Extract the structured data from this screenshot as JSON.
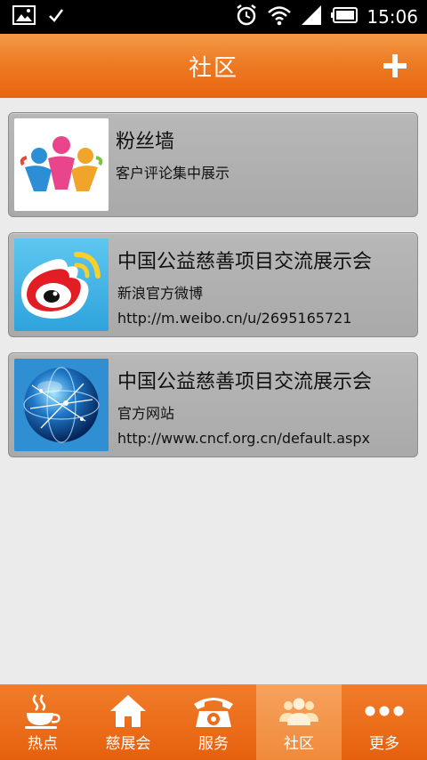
{
  "status_bar": {
    "time": "15:06"
  },
  "header": {
    "title": "社区",
    "add_icon": "plus-icon"
  },
  "cards": [
    {
      "title": "粉丝墙",
      "subtitle": "客户评论集中展示",
      "link": "",
      "thumb_icon": "fans-wall-logo"
    },
    {
      "title": "中国公益慈善项目交流展示会",
      "subtitle": "新浪官方微博",
      "link": "http://m.weibo.cn/u/2695165721",
      "thumb_icon": "weibo-logo"
    },
    {
      "title": "中国公益慈善项目交流展示会",
      "subtitle": "官方网站",
      "link": "http://www.cncf.org.cn/default.aspx",
      "thumb_icon": "globe-logo"
    }
  ],
  "nav": [
    {
      "label": "热点",
      "icon": "coffee-cup-icon"
    },
    {
      "label": "慈展会",
      "icon": "home-icon"
    },
    {
      "label": "服务",
      "icon": "telephone-icon"
    },
    {
      "label": "社区",
      "icon": "people-icon",
      "active": true
    },
    {
      "label": "更多",
      "icon": "more-dots-icon"
    }
  ],
  "colors": {
    "accent": "#ee7b25",
    "active_tab": "#f59a50"
  }
}
